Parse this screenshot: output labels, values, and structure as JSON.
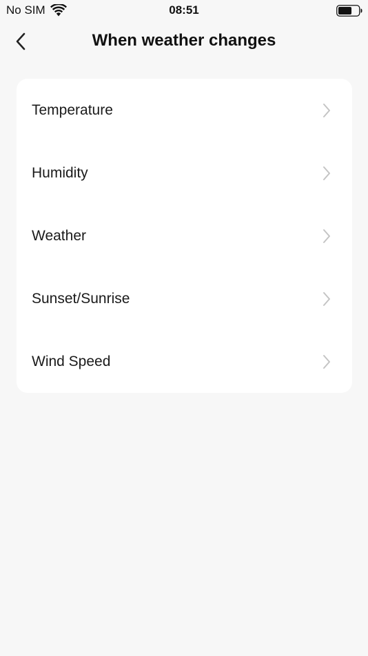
{
  "status_bar": {
    "carrier": "No SIM",
    "time": "08:51"
  },
  "nav": {
    "title": "When weather changes",
    "back_icon": "chevron-left-icon"
  },
  "list": {
    "items": [
      {
        "label": "Temperature"
      },
      {
        "label": "Humidity"
      },
      {
        "label": "Weather"
      },
      {
        "label": "Sunset/Sunrise"
      },
      {
        "label": "Wind Speed"
      }
    ],
    "chevron_icon": "chevron-right-icon",
    "chevron_color": "#c4c4c4"
  },
  "colors": {
    "background": "#f7f7f7",
    "card": "#ffffff",
    "text": "#111111"
  }
}
